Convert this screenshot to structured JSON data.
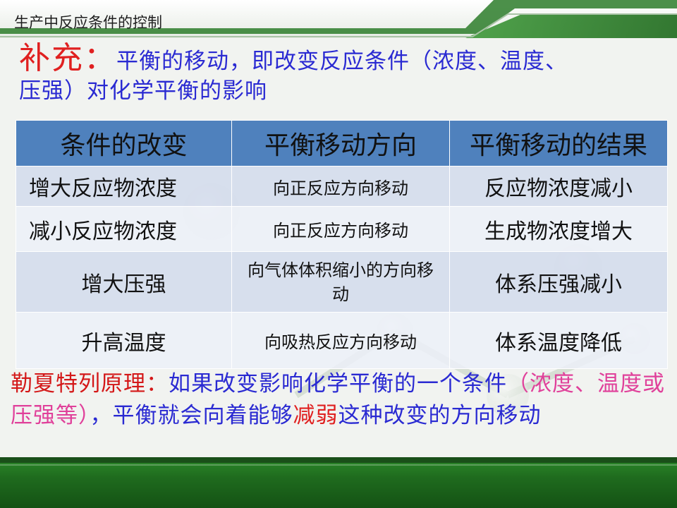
{
  "header": {
    "title": "生产中反应条件的控制"
  },
  "intro": {
    "lead": "补充：",
    "line1": "平衡的移动，即改变反应条件（浓度、温度、",
    "line2": "压强）对化学平衡的影响"
  },
  "table": {
    "headers": [
      "条件的改变",
      "平衡移动方向",
      "平衡移动的结果"
    ],
    "rows": [
      [
        "增大反应物浓度",
        "向正反应方向移动",
        "反应物浓度减小"
      ],
      [
        "减小反应物浓度",
        "向正反应方向移动",
        "生成物浓度增大"
      ],
      [
        "增大压强",
        "向气体体积缩小的方向移动",
        "体系压强减小"
      ],
      [
        "升高温度",
        "向吸热反应方向移动",
        "体系温度降低"
      ]
    ]
  },
  "principle": {
    "title": "勒夏特列原理：",
    "part1": "如果改变影响化学平衡的一个条件",
    "paren": "（浓度、温度或压强等）",
    "part2": "，平衡就会向着能够",
    "emph": "减弱",
    "part3": "这种改变的方向移动"
  },
  "colors": {
    "blue_text": "#2a2ad2",
    "red_text": "#e02020",
    "pink_text": "#e0409a",
    "header_blue": "#4f81bd",
    "green_band": "#1f6b1e"
  }
}
